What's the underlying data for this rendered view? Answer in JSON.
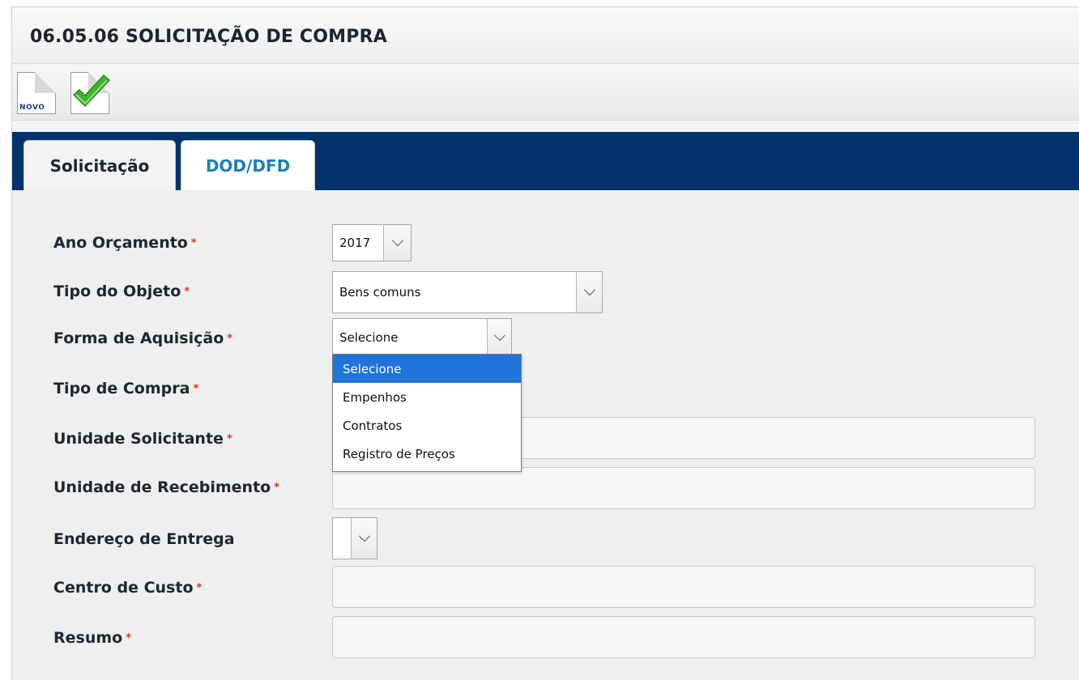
{
  "window": {
    "title": "06.05.06 SOLICITAÇÃO DE COMPRA"
  },
  "toolbar": {
    "new_label": "NOVO",
    "new_icon": "new-document-icon",
    "confirm_icon": "checkmark-icon"
  },
  "tabs": [
    {
      "label": "Solicitação",
      "active": true
    },
    {
      "label": "DOD/DFD",
      "active": false
    }
  ],
  "form": {
    "required_marker": "*",
    "ano_orcamento": {
      "label": "Ano Orçamento",
      "value": "2017"
    },
    "tipo_objeto": {
      "label": "Tipo do Objeto",
      "value": "Bens comuns"
    },
    "forma_aquisicao": {
      "label": "Forma de Aquisição",
      "value": "Selecione",
      "options": [
        "Selecione",
        "Empenhos",
        "Contratos",
        "Registro de Preços"
      ]
    },
    "tipo_compra": {
      "label": "Tipo de Compra"
    },
    "unidade_solicitante": {
      "label": "Unidade Solicitante",
      "value": ""
    },
    "unidade_recebimento": {
      "label": "Unidade de Recebimento",
      "value": ""
    },
    "endereco_entrega": {
      "label": "Endereço de Entrega",
      "value": ""
    },
    "centro_custo": {
      "label": "Centro de Custo",
      "value": ""
    },
    "resumo": {
      "label": "Resumo",
      "value": ""
    }
  },
  "colors": {
    "tabbar": "#00336a",
    "selected_option": "#1f73d9",
    "required": "#d8352a",
    "inactive_tab_text": "#1e80b8"
  }
}
